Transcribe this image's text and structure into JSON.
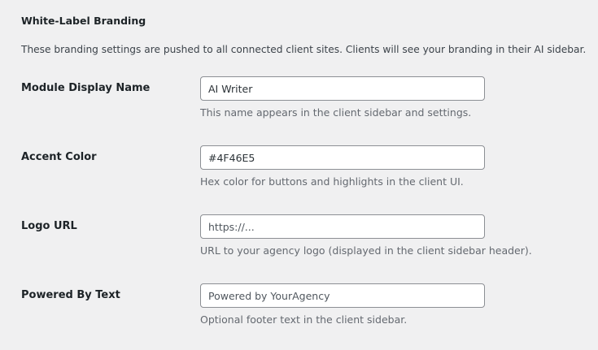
{
  "section": {
    "title": "White-Label Branding",
    "description": "These branding settings are pushed to all connected client sites. Clients will see your branding in their AI sidebar."
  },
  "fields": [
    {
      "label": "Module Display Name",
      "value": "AI Writer",
      "placeholder": "",
      "help": "This name appears in the client sidebar and settings."
    },
    {
      "label": "Accent Color",
      "value": "#4F46E5",
      "placeholder": "",
      "help": "Hex color for buttons and highlights in the client UI."
    },
    {
      "label": "Logo URL",
      "value": "",
      "placeholder": "https://...",
      "help": "URL to your agency logo (displayed in the client sidebar header)."
    },
    {
      "label": "Powered By Text",
      "value": "",
      "placeholder": "Powered by YourAgency",
      "help": "Optional footer text in the client sidebar."
    }
  ]
}
